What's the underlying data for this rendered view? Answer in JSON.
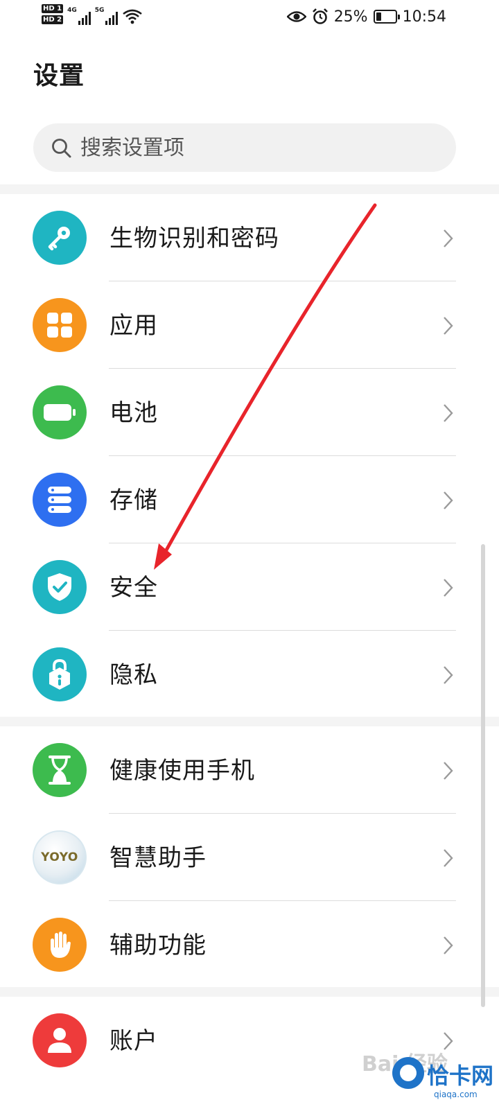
{
  "statusbar": {
    "hd1": "HD 1",
    "hd2": "HD 2",
    "net1": "4G",
    "net2": "5G",
    "battery_percent": "25%",
    "battery_level": 0.25,
    "time": "10:54"
  },
  "header": {
    "title": "设置"
  },
  "search": {
    "placeholder": "搜索设置项"
  },
  "groups": [
    {
      "items": [
        {
          "label": "生物识别和密码",
          "icon": "key-icon",
          "color": "#1fb5c2"
        },
        {
          "label": "应用",
          "icon": "apps-grid-icon",
          "color": "#f7951d"
        },
        {
          "label": "电池",
          "icon": "battery-icon",
          "color": "#3dbb4e"
        },
        {
          "label": "存储",
          "icon": "storage-icon",
          "color": "#2e6ff0"
        },
        {
          "label": "安全",
          "icon": "shield-check-icon",
          "color": "#1fb5c2"
        },
        {
          "label": "隐私",
          "icon": "privacy-lock-icon",
          "color": "#1fb5c2"
        }
      ]
    },
    {
      "items": [
        {
          "label": "健康使用手机",
          "icon": "hourglass-icon",
          "color": "#3dbb4e"
        },
        {
          "label": "智慧助手",
          "icon": "yoyo-icon",
          "color": "#e8eef2",
          "badge_text": "YOYO"
        },
        {
          "label": "辅助功能",
          "icon": "hand-icon",
          "color": "#f7951d"
        }
      ]
    },
    {
      "items": [
        {
          "label": "账户",
          "icon": "account-icon",
          "color": "#ee3b3b"
        }
      ]
    }
  ],
  "watermark": {
    "brand": "恰卡网",
    "url": "qiaqa.com"
  },
  "colors": {
    "accent_arrow": "#e8242b"
  }
}
